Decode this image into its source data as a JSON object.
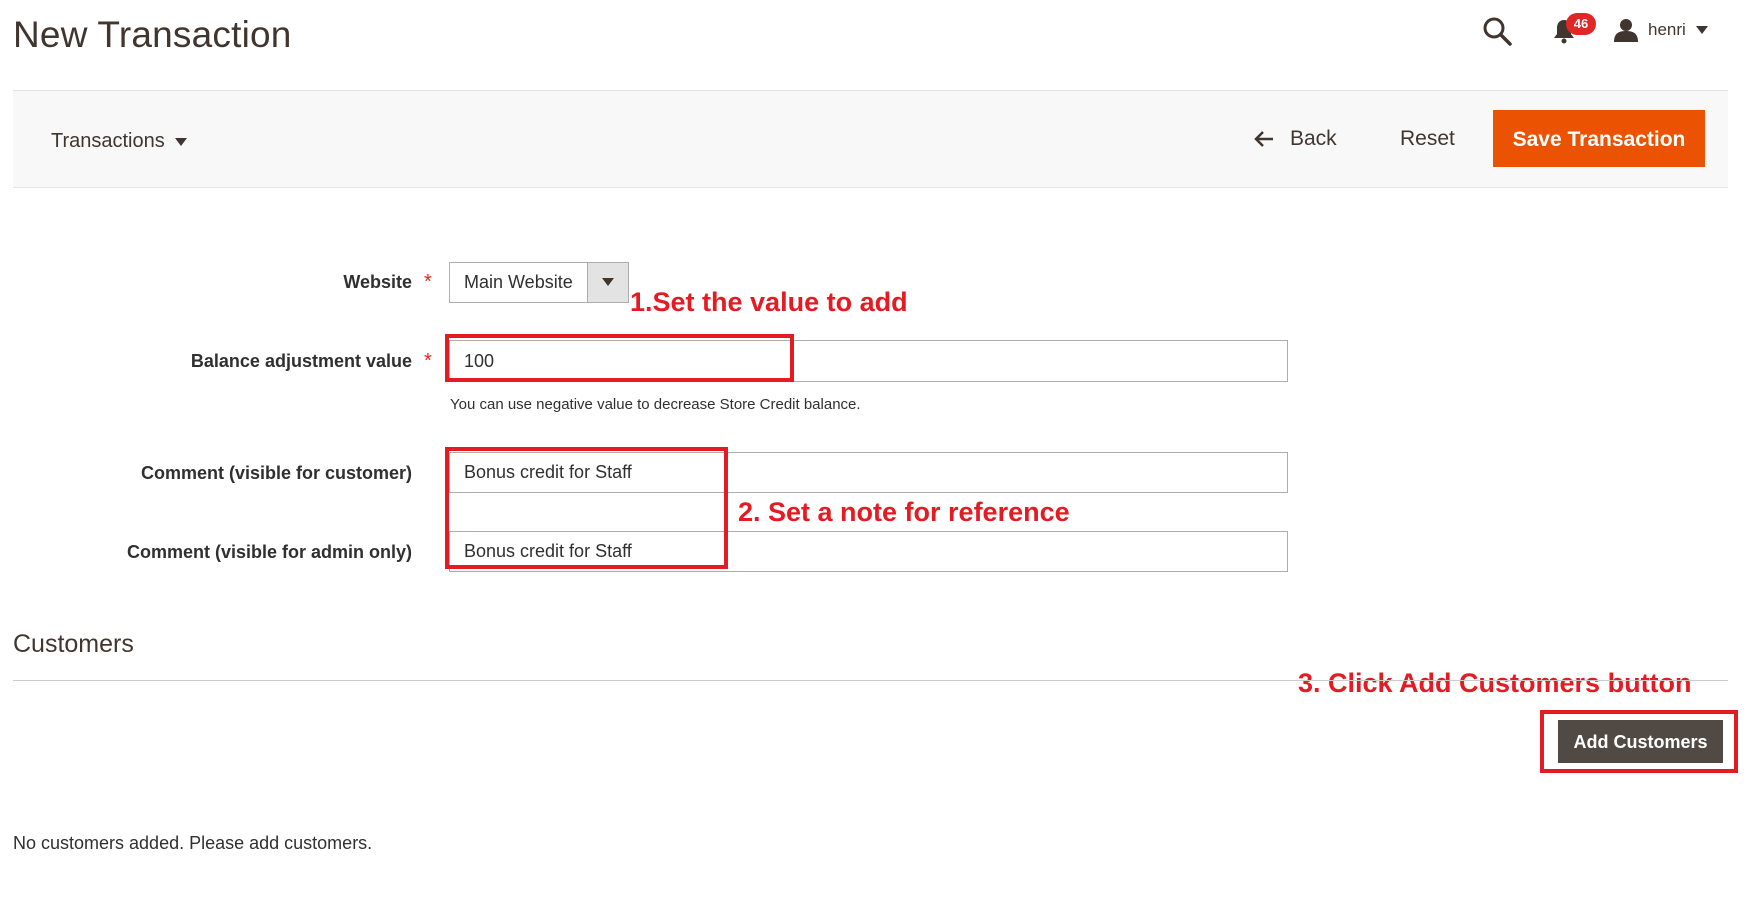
{
  "header": {
    "title": "New Transaction",
    "notification_count": "46",
    "user_name": "henri"
  },
  "action_bar": {
    "scope_label": "Transactions",
    "back_label": "Back",
    "reset_label": "Reset",
    "save_label": "Save Transaction"
  },
  "form": {
    "website": {
      "label": "Website",
      "value": "Main Website"
    },
    "balance": {
      "label": "Balance adjustment value",
      "value": "100",
      "note": "You can use negative value to decrease Store Credit balance."
    },
    "comment_customer": {
      "label": "Comment (visible for customer)",
      "value": "Bonus credit for Staff"
    },
    "comment_admin": {
      "label": "Comment (visible for admin only)",
      "value": "Bonus credit for Staff"
    },
    "required_marker": "*"
  },
  "customers": {
    "title": "Customers",
    "add_button_label": "Add Customers",
    "empty_message": "No customers added. Please add customers."
  },
  "annotations": {
    "step1": "1.Set the value to add",
    "step2": "2. Set a note for reference",
    "step3": "3. Click Add Customers button"
  },
  "colors": {
    "accent": "#eb5202",
    "annotation": "#e41b23",
    "badge": "#e22626",
    "secondary_button": "#514943"
  },
  "icons": [
    "search-icon",
    "bell-icon",
    "user-icon",
    "chevron-down-icon",
    "arrow-left-icon"
  ]
}
